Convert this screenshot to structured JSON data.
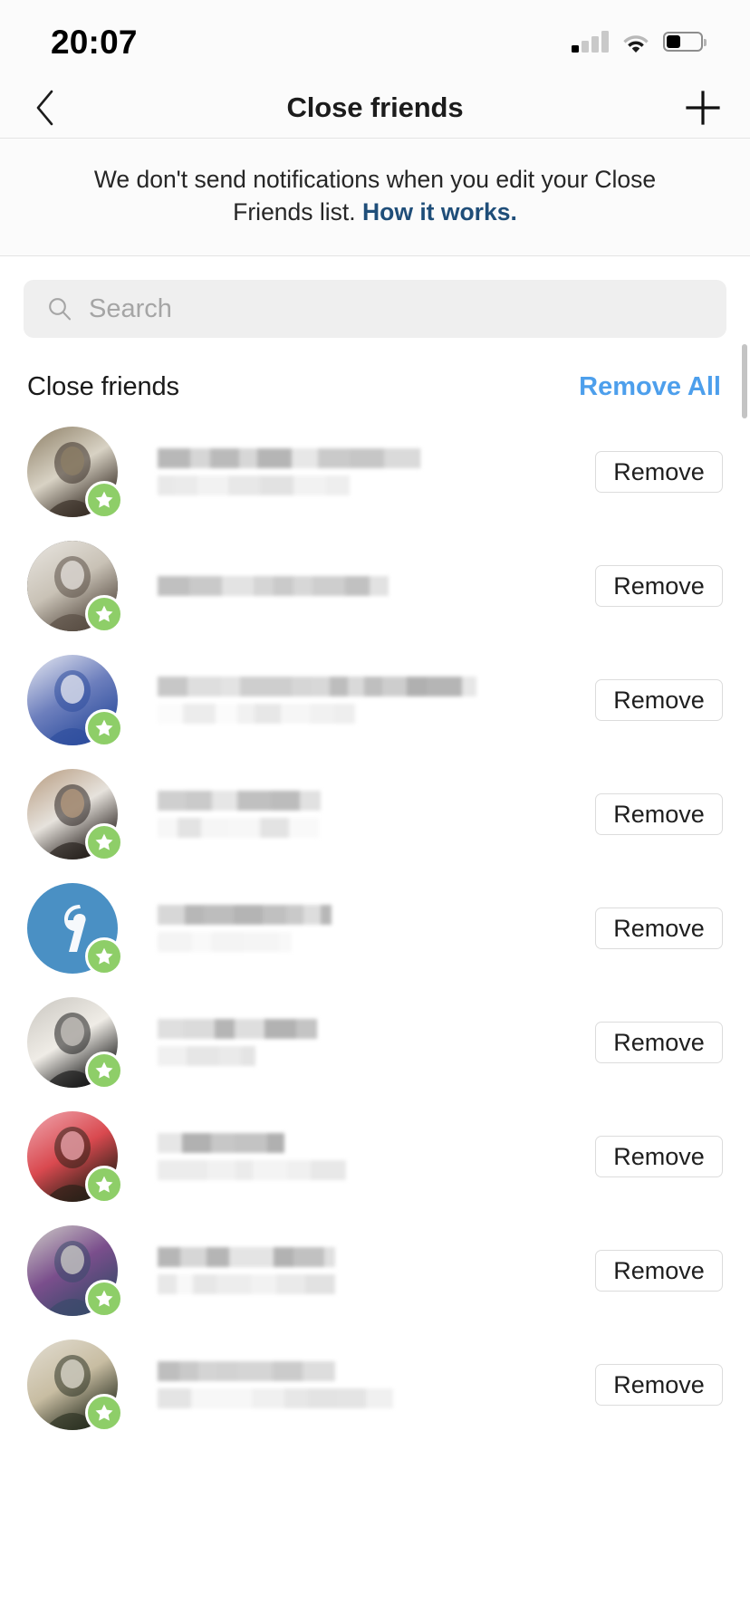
{
  "status_bar": {
    "time": "20:07",
    "signal_icon": "cellular-signal-icon",
    "signal_bars_total": 4,
    "signal_bars_active": 1,
    "wifi_icon": "wifi-icon",
    "battery_icon": "battery-icon",
    "battery_percent": 42
  },
  "nav": {
    "back_icon": "chevron-left-icon",
    "title": "Close friends",
    "add_icon": "plus-icon"
  },
  "notice": {
    "text": "We don't send notifications when you edit your Close Friends list. ",
    "link_text": "How it works.",
    "link_color": "#1f4e79"
  },
  "search": {
    "icon": "search-icon",
    "value": "",
    "placeholder": "Search"
  },
  "section": {
    "title": "Close friends",
    "action_label": "Remove All",
    "action_color": "#4d9fec"
  },
  "list": {
    "remove_label": "Remove",
    "badge_icon": "star-badge-icon",
    "badge_color": "#8ece68",
    "rows": [
      {
        "avatar_name": "avatar-photo-person-peace-sign",
        "avatar_colors": [
          "#8d7f66",
          "#3a3028",
          "#d8d2c4"
        ],
        "avatar_ring": false,
        "is_close_friend": true,
        "name_redacted": true,
        "username_redacted": true,
        "name_bar_width": 290,
        "username_bar_width": 212,
        "remove_label": "Remove"
      },
      {
        "avatar_name": "avatar-photo-man-white-hoodie",
        "avatar_colors": [
          "#e9e6e1",
          "#5a4f45",
          "#c9c2b6"
        ],
        "avatar_ring": true,
        "is_close_friend": true,
        "name_redacted": true,
        "username_redacted": false,
        "name_bar_width": 255,
        "username_bar_width": 0,
        "remove_label": "Remove"
      },
      {
        "avatar_name": "avatar-photo-man-blue-jacket-phone",
        "avatar_colors": [
          "#e8eaf2",
          "#2f4f9e",
          "#6d7fbd"
        ],
        "avatar_ring": false,
        "is_close_friend": true,
        "name_redacted": true,
        "username_redacted": true,
        "name_bar_width": 352,
        "username_bar_width": 218,
        "remove_label": "Remove"
      },
      {
        "avatar_name": "avatar-photo-man-black-cap",
        "avatar_colors": [
          "#b69a7e",
          "#2a2320",
          "#e6e2dc"
        ],
        "avatar_ring": false,
        "is_close_friend": true,
        "name_redacted": true,
        "username_redacted": true,
        "name_bar_width": 180,
        "username_bar_width": 178,
        "remove_label": "Remove"
      },
      {
        "avatar_name": "avatar-logo-blue-circle",
        "avatar_colors": [
          "#4a90c4",
          "#4a90c4",
          "#ffffff"
        ],
        "avatar_ring": false,
        "is_close_friend": true,
        "name_redacted": true,
        "username_redacted": true,
        "name_bar_width": 192,
        "username_bar_width": 148,
        "remove_label": "Remove"
      },
      {
        "avatar_name": "avatar-photo-woman-white-dress",
        "avatar_colors": [
          "#c9c6c0",
          "#1d1d1d",
          "#efece6"
        ],
        "avatar_ring": false,
        "is_close_friend": true,
        "name_redacted": true,
        "username_redacted": true,
        "name_bar_width": 176,
        "username_bar_width": 108,
        "remove_label": "Remove"
      },
      {
        "avatar_name": "avatar-photo-man-turban-pink",
        "avatar_colors": [
          "#f0a8b0",
          "#2b2118",
          "#d9494f"
        ],
        "avatar_ring": false,
        "is_close_friend": true,
        "name_redacted": true,
        "username_redacted": true,
        "name_bar_width": 140,
        "username_bar_width": 208,
        "remove_label": "Remove"
      },
      {
        "avatar_name": "avatar-photo-man-denim-jacket",
        "avatar_colors": [
          "#cfcdc8",
          "#3b4a6b",
          "#7a4e8c"
        ],
        "avatar_ring": false,
        "is_close_friend": true,
        "name_redacted": true,
        "username_redacted": true,
        "name_bar_width": 196,
        "username_bar_width": 196,
        "remove_label": "Remove"
      },
      {
        "avatar_name": "avatar-photo-champagne-bottle",
        "avatar_colors": [
          "#e2ddd2",
          "#2e3324",
          "#c8bda2"
        ],
        "avatar_ring": false,
        "is_close_friend": true,
        "name_redacted": true,
        "username_redacted": true,
        "name_bar_width": 196,
        "username_bar_width": 260,
        "remove_label": "Remove"
      }
    ]
  },
  "scrollbar": {
    "visible": true
  }
}
